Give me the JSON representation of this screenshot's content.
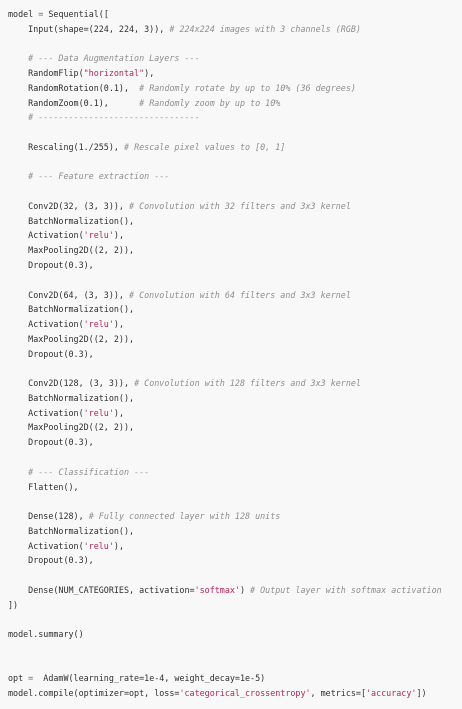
{
  "colors": {
    "background": "#f8f8f8",
    "text": "#2f2f2f",
    "string": "#b3265c",
    "comment": "#8e8e8e"
  },
  "code_lines": [
    [
      {
        "t": "model ",
        "k": "default"
      },
      {
        "t": "=",
        "k": "op"
      },
      {
        "t": " Sequential([",
        "k": "default"
      }
    ],
    [
      {
        "t": "    Input(shape=(224, 224, 3)), ",
        "k": "default"
      },
      {
        "t": "# 224x224 images with 3 channels (RGB)",
        "k": "comment"
      }
    ],
    [],
    [
      {
        "t": "    ",
        "k": "default"
      },
      {
        "t": "# --- Data Augmentation Layers ---",
        "k": "comment"
      }
    ],
    [
      {
        "t": "    RandomFlip(",
        "k": "default"
      },
      {
        "t": "\"horizontal\"",
        "k": "str"
      },
      {
        "t": "),",
        "k": "default"
      }
    ],
    [
      {
        "t": "    RandomRotation(0.1),  ",
        "k": "default"
      },
      {
        "t": "# Randomly rotate by up to 10% (36 degrees)",
        "k": "comment"
      }
    ],
    [
      {
        "t": "    RandomZoom(0.1),      ",
        "k": "default"
      },
      {
        "t": "# Randomly zoom by up to 10%",
        "k": "comment"
      }
    ],
    [
      {
        "t": "    ",
        "k": "default"
      },
      {
        "t": "# --------------------------------",
        "k": "comment"
      }
    ],
    [],
    [
      {
        "t": "    Rescaling(1./255), ",
        "k": "default"
      },
      {
        "t": "# Rescale pixel values to [0, 1]",
        "k": "comment"
      }
    ],
    [],
    [
      {
        "t": "    ",
        "k": "default"
      },
      {
        "t": "# --- Feature extraction ---",
        "k": "comment"
      }
    ],
    [],
    [
      {
        "t": "    Conv2D(32, (3, 3)), ",
        "k": "default"
      },
      {
        "t": "# Convolution with 32 filters and 3x3 kernel",
        "k": "comment"
      }
    ],
    [
      {
        "t": "    BatchNormalization(),",
        "k": "default"
      }
    ],
    [
      {
        "t": "    Activation(",
        "k": "default"
      },
      {
        "t": "'relu'",
        "k": "str"
      },
      {
        "t": "),",
        "k": "default"
      }
    ],
    [
      {
        "t": "    MaxPooling2D((2, 2)),",
        "k": "default"
      }
    ],
    [
      {
        "t": "    Dropout(0.3),",
        "k": "default"
      }
    ],
    [],
    [
      {
        "t": "    Conv2D(64, (3, 3)), ",
        "k": "default"
      },
      {
        "t": "# Convolution with 64 filters and 3x3 kernel",
        "k": "comment"
      }
    ],
    [
      {
        "t": "    BatchNormalization(),",
        "k": "default"
      }
    ],
    [
      {
        "t": "    Activation(",
        "k": "default"
      },
      {
        "t": "'relu'",
        "k": "str"
      },
      {
        "t": "),",
        "k": "default"
      }
    ],
    [
      {
        "t": "    MaxPooling2D((2, 2)),",
        "k": "default"
      }
    ],
    [
      {
        "t": "    Dropout(0.3),",
        "k": "default"
      }
    ],
    [],
    [
      {
        "t": "    Conv2D(128, (3, 3)), ",
        "k": "default"
      },
      {
        "t": "# Convolution with 128 filters and 3x3 kernel",
        "k": "comment"
      }
    ],
    [
      {
        "t": "    BatchNormalization(),",
        "k": "default"
      }
    ],
    [
      {
        "t": "    Activation(",
        "k": "default"
      },
      {
        "t": "'relu'",
        "k": "str"
      },
      {
        "t": "),",
        "k": "default"
      }
    ],
    [
      {
        "t": "    MaxPooling2D((2, 2)),",
        "k": "default"
      }
    ],
    [
      {
        "t": "    Dropout(0.3),",
        "k": "default"
      }
    ],
    [],
    [
      {
        "t": "    ",
        "k": "default"
      },
      {
        "t": "# --- Classification ---",
        "k": "comment"
      }
    ],
    [
      {
        "t": "    Flatten(),",
        "k": "default"
      }
    ],
    [],
    [
      {
        "t": "    Dense(128), ",
        "k": "default"
      },
      {
        "t": "# Fully connected layer with 128 units",
        "k": "comment"
      }
    ],
    [
      {
        "t": "    BatchNormalization(),",
        "k": "default"
      }
    ],
    [
      {
        "t": "    Activation(",
        "k": "default"
      },
      {
        "t": "'relu'",
        "k": "str"
      },
      {
        "t": "),",
        "k": "default"
      }
    ],
    [
      {
        "t": "    Dropout(0.3),",
        "k": "default"
      }
    ],
    [],
    [
      {
        "t": "    Dense(NUM_CATEGORIES, activation=",
        "k": "default"
      },
      {
        "t": "'softmax'",
        "k": "str"
      },
      {
        "t": ") ",
        "k": "default"
      },
      {
        "t": "# Output layer with softmax activation",
        "k": "comment"
      }
    ],
    [
      {
        "t": "])",
        "k": "default"
      }
    ],
    [],
    [
      {
        "t": "model.summary()",
        "k": "default"
      }
    ],
    [],
    [],
    [
      {
        "t": "opt ",
        "k": "default"
      },
      {
        "t": "=",
        "k": "op"
      },
      {
        "t": "  AdamW(learning_rate=1e-4, weight_decay=1e-5)",
        "k": "default"
      }
    ],
    [
      {
        "t": "model.compile(optimizer=opt, loss=",
        "k": "default"
      },
      {
        "t": "'categorical_crossentropy'",
        "k": "str"
      },
      {
        "t": ", metrics=[",
        "k": "default"
      },
      {
        "t": "'accuracy'",
        "k": "str"
      },
      {
        "t": "])",
        "k": "default"
      }
    ]
  ]
}
